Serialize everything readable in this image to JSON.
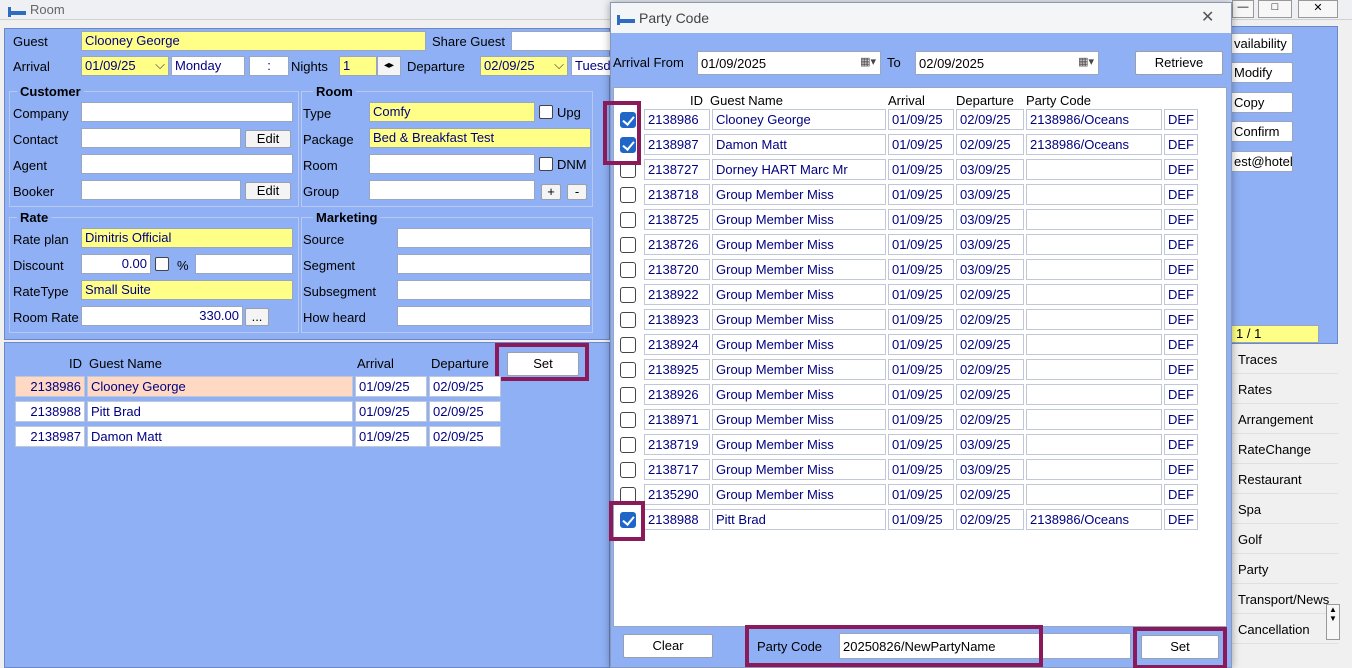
{
  "room_window": {
    "title": "Room",
    "window_controls": [
      "—",
      "□",
      "✕"
    ],
    "labels": {
      "guest": "Guest",
      "share_guest": "Share Guest",
      "arrival": "Arrival",
      "nights": "Nights",
      "departure": "Departure",
      "customer": "Customer",
      "company": "Company",
      "contact": "Contact",
      "agent": "Agent",
      "booker": "Booker",
      "room": "Room",
      "type": "Type",
      "package": "Package",
      "room_lbl": "Room",
      "group": "Group",
      "rate": "Rate",
      "rate_plan": "Rate plan",
      "discount": "Discount",
      "ratetype": "RateType",
      "room_rate": "Room Rate",
      "marketing": "Marketing",
      "source": "Source",
      "segment": "Segment",
      "subsegment": "Subsegment",
      "how_heard": "How heard"
    },
    "values": {
      "guest": "Clooney George",
      "arrival_date": "01/09/25",
      "arrival_day": "Monday",
      "time": ":",
      "nights": "1",
      "departure_date": "02/09/25",
      "departure_day": "Tuesd",
      "type": "Comfy",
      "upg": "Upg",
      "package": "Bed & Breakfast Test",
      "dnm": "DNM",
      "rate_plan": "Dimitris Official",
      "discount": "0.00",
      "percent": "%",
      "ratetype": "Small Suite",
      "room_rate": "330.00"
    },
    "buttons": {
      "edit": "Edit",
      "plus": "+",
      "minus": "-",
      "ellipsis": "...",
      "set": "Set"
    },
    "list": {
      "headers": [
        "ID",
        "Guest Name",
        "Arrival",
        "Departure"
      ],
      "rows": [
        [
          "2138986",
          "Clooney George",
          "01/09/25",
          "02/09/25"
        ],
        [
          "2138988",
          "Pitt Brad",
          "01/09/25",
          "02/09/25"
        ],
        [
          "2138987",
          "Damon Matt",
          "01/09/25",
          "02/09/25"
        ]
      ]
    },
    "right_buttons": [
      "vailability",
      "Modify",
      "Copy",
      "Confirm",
      "est@hotel"
    ],
    "pager": "1 / 1",
    "tabs": [
      "Traces",
      "Rates",
      "Arrangement",
      "RateChange",
      "Restaurant",
      "Spa",
      "Golf",
      "Party",
      "Transport/News",
      "Cancellation"
    ]
  },
  "party_dialog": {
    "title": "Party Code",
    "close": "✕",
    "arrival_from_label": "Arrival From",
    "from_date": "01/09/2025",
    "to_label": "To",
    "to_date": "02/09/2025",
    "retrieve": "Retrieve",
    "headers": [
      "ID",
      "Guest Name",
      "Arrival",
      "Departure",
      "Party Code"
    ],
    "rows": [
      {
        "checked": true,
        "id": "2138986",
        "name": "Clooney George",
        "arrival": "01/09/25",
        "departure": "02/09/25",
        "party": "2138986/Oceans",
        "code": "DEF"
      },
      {
        "checked": true,
        "id": "2138987",
        "name": "Damon Matt",
        "arrival": "01/09/25",
        "departure": "02/09/25",
        "party": "2138986/Oceans",
        "code": "DEF"
      },
      {
        "checked": false,
        "id": "2138727",
        "name": "Dorney HART Marc Mr",
        "arrival": "01/09/25",
        "departure": "03/09/25",
        "party": "",
        "code": "DEF"
      },
      {
        "checked": false,
        "id": "2138718",
        "name": "Group Member Miss",
        "arrival": "01/09/25",
        "departure": "03/09/25",
        "party": "",
        "code": "DEF"
      },
      {
        "checked": false,
        "id": "2138725",
        "name": "Group Member Miss",
        "arrival": "01/09/25",
        "departure": "03/09/25",
        "party": "",
        "code": "DEF"
      },
      {
        "checked": false,
        "id": "2138726",
        "name": "Group Member Miss",
        "arrival": "01/09/25",
        "departure": "03/09/25",
        "party": "",
        "code": "DEF"
      },
      {
        "checked": false,
        "id": "2138720",
        "name": "Group Member Miss",
        "arrival": "01/09/25",
        "departure": "03/09/25",
        "party": "",
        "code": "DEF"
      },
      {
        "checked": false,
        "id": "2138922",
        "name": "Group Member Miss",
        "arrival": "01/09/25",
        "departure": "02/09/25",
        "party": "",
        "code": "DEF"
      },
      {
        "checked": false,
        "id": "2138923",
        "name": "Group Member Miss",
        "arrival": "01/09/25",
        "departure": "02/09/25",
        "party": "",
        "code": "DEF"
      },
      {
        "checked": false,
        "id": "2138924",
        "name": "Group Member Miss",
        "arrival": "01/09/25",
        "departure": "02/09/25",
        "party": "",
        "code": "DEF"
      },
      {
        "checked": false,
        "id": "2138925",
        "name": "Group Member Miss",
        "arrival": "01/09/25",
        "departure": "02/09/25",
        "party": "",
        "code": "DEF"
      },
      {
        "checked": false,
        "id": "2138926",
        "name": "Group Member Miss",
        "arrival": "01/09/25",
        "departure": "02/09/25",
        "party": "",
        "code": "DEF"
      },
      {
        "checked": false,
        "id": "2138971",
        "name": "Group Member Miss",
        "arrival": "01/09/25",
        "departure": "02/09/25",
        "party": "",
        "code": "DEF"
      },
      {
        "checked": false,
        "id": "2138719",
        "name": "Group Member Miss",
        "arrival": "01/09/25",
        "departure": "03/09/25",
        "party": "",
        "code": "DEF"
      },
      {
        "checked": false,
        "id": "2138717",
        "name": "Group Member Miss",
        "arrival": "01/09/25",
        "departure": "03/09/25",
        "party": "",
        "code": "DEF"
      },
      {
        "checked": false,
        "id": "2135290",
        "name": "Group Member Miss",
        "arrival": "01/09/25",
        "departure": "02/09/25",
        "party": "",
        "code": "DEF"
      },
      {
        "checked": true,
        "id": "2138988",
        "name": "Pitt Brad",
        "arrival": "01/09/25",
        "departure": "02/09/25",
        "party": "2138986/Oceans",
        "code": "DEF"
      }
    ],
    "clear": "Clear",
    "party_code_label": "Party Code",
    "party_code_value": "20250826/NewPartyName",
    "set": "Set"
  },
  "colors": {
    "panel": "#8fb0f5",
    "highlight": "#8b1a5a",
    "field_yellow": "#ffff88",
    "text_blue": "#000080",
    "check_blue": "#1f66c8"
  }
}
